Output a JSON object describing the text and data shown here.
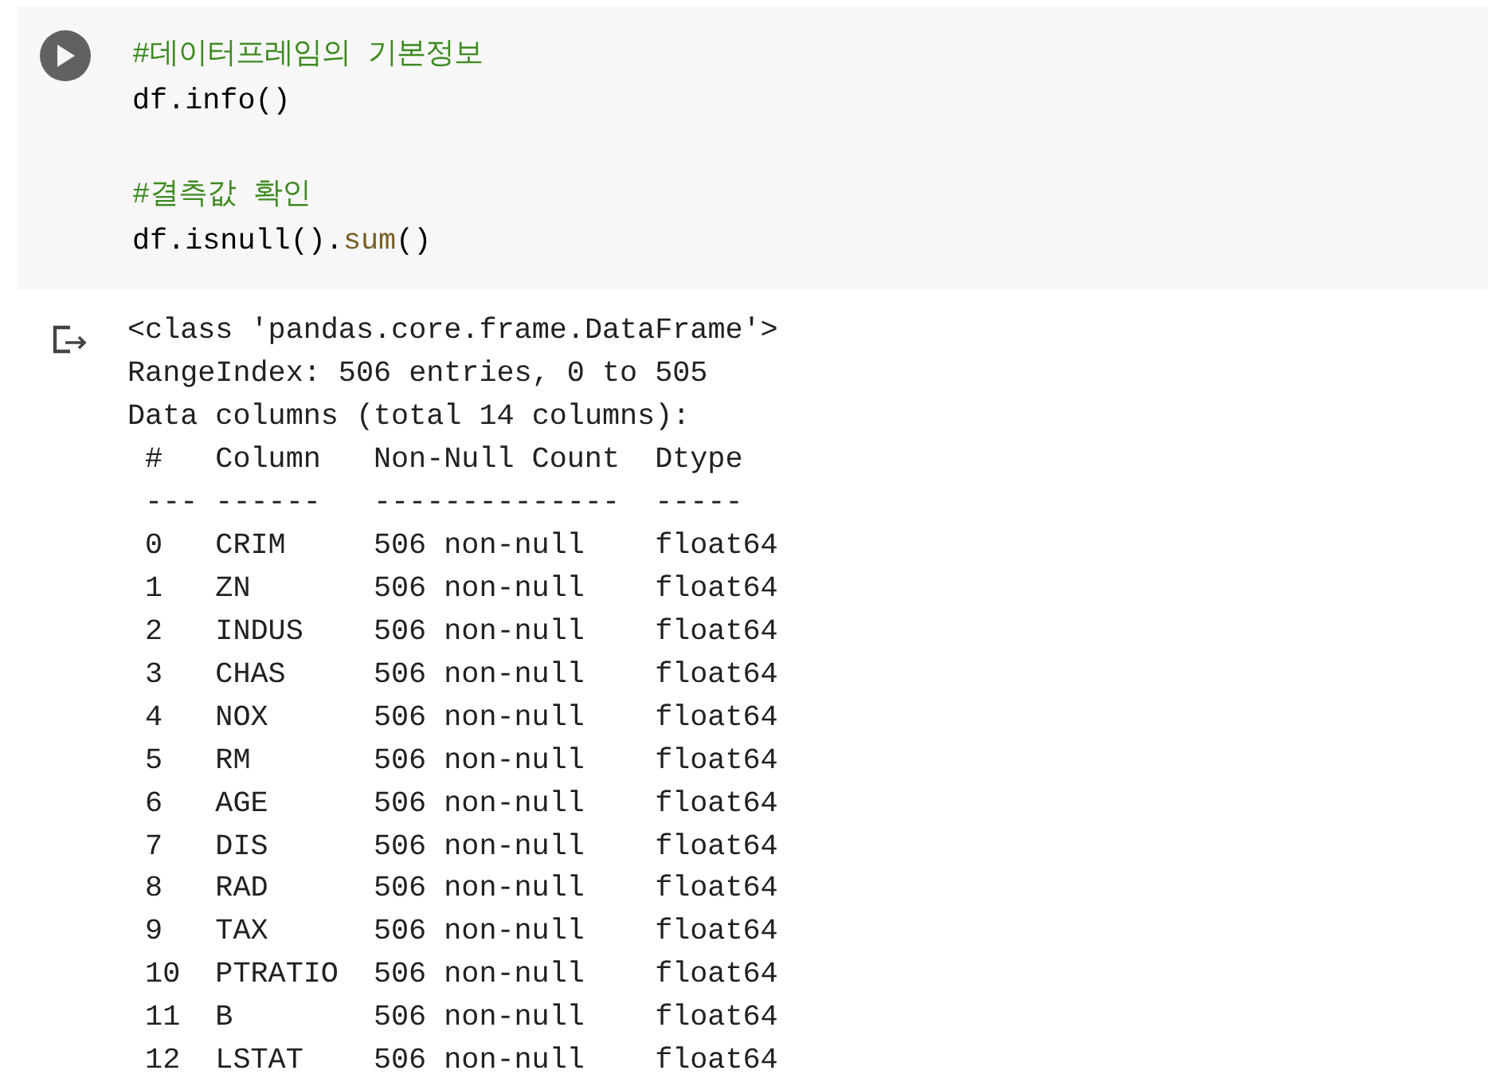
{
  "code_cell": {
    "lines": [
      {
        "kind": "code",
        "tokens": [
          {
            "kind": "comment",
            "text": "#데이터프레임의 기본정보"
          }
        ]
      },
      {
        "kind": "code",
        "tokens": [
          {
            "kind": "plain",
            "text": "df.info()"
          }
        ]
      },
      {
        "kind": "blank"
      },
      {
        "kind": "code",
        "tokens": [
          {
            "kind": "comment",
            "text": "#결측값 확인"
          }
        ]
      },
      {
        "kind": "code",
        "tokens": [
          {
            "kind": "plain",
            "text": "df.isnull()."
          },
          {
            "kind": "function",
            "text": "sum"
          },
          {
            "kind": "plain",
            "text": "()"
          }
        ]
      }
    ]
  },
  "output": {
    "lines": [
      "<class 'pandas.core.frame.DataFrame'>",
      "RangeIndex: 506 entries, 0 to 505",
      "Data columns (total 14 columns):"
    ],
    "table": {
      "columns": [
        "#",
        "Column",
        "Non-Null Count",
        "Dtype"
      ],
      "separators": [
        "---",
        "------",
        "--------------",
        "-----"
      ],
      "rows": [
        {
          "index": "0",
          "column": "CRIM",
          "count": "506 non-null",
          "dtype": "float64"
        },
        {
          "index": "1",
          "column": "ZN",
          "count": "506 non-null",
          "dtype": "float64"
        },
        {
          "index": "2",
          "column": "INDUS",
          "count": "506 non-null",
          "dtype": "float64"
        },
        {
          "index": "3",
          "column": "CHAS",
          "count": "506 non-null",
          "dtype": "float64"
        },
        {
          "index": "4",
          "column": "NOX",
          "count": "506 non-null",
          "dtype": "float64"
        },
        {
          "index": "5",
          "column": "RM",
          "count": "506 non-null",
          "dtype": "float64"
        },
        {
          "index": "6",
          "column": "AGE",
          "count": "506 non-null",
          "dtype": "float64"
        },
        {
          "index": "7",
          "column": "DIS",
          "count": "506 non-null",
          "dtype": "float64"
        },
        {
          "index": "8",
          "column": "RAD",
          "count": "506 non-null",
          "dtype": "float64"
        },
        {
          "index": "9",
          "column": "TAX",
          "count": "506 non-null",
          "dtype": "float64"
        },
        {
          "index": "10",
          "column": "PTRATIO",
          "count": "506 non-null",
          "dtype": "float64"
        },
        {
          "index": "11",
          "column": "B",
          "count": "506 non-null",
          "dtype": "float64"
        },
        {
          "index": "12",
          "column": "LSTAT",
          "count": "506 non-null",
          "dtype": "float64"
        }
      ]
    }
  }
}
